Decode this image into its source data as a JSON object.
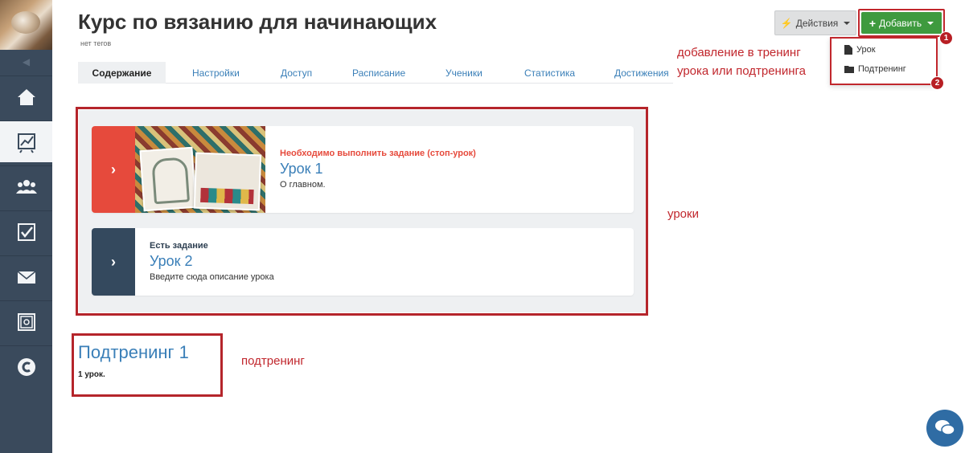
{
  "header": {
    "title": "Курс по вязанию для начинающих",
    "tags": "нет тегов",
    "actions_label": "Действия",
    "add_label": "Добавить"
  },
  "dropdown": {
    "items": [
      {
        "label": "Урок",
        "icon": "file-icon"
      },
      {
        "label": "Подтренинг",
        "icon": "folder-icon"
      }
    ],
    "badges": [
      "1",
      "2"
    ]
  },
  "tabs": [
    {
      "label": "Содержание",
      "active": true
    },
    {
      "label": "Настройки"
    },
    {
      "label": "Доступ"
    },
    {
      "label": "Расписание"
    },
    {
      "label": "Ученики"
    },
    {
      "label": "Статистика"
    },
    {
      "label": "Достижения"
    }
  ],
  "lessons": [
    {
      "status": "Необходимо выполнить задание (стоп-урок)",
      "title": "Урок 1",
      "description": "О главном.",
      "accent": "#e64a3c"
    },
    {
      "status": "Есть задание",
      "title": "Урок 2",
      "description": "Введите сюда описание урока",
      "accent": "#34495e"
    }
  ],
  "subtraining": {
    "title": "Подтренинг 1",
    "count": "1 урок."
  },
  "annotations": {
    "add_line1": "добавление в тренинг",
    "add_line2": "урока или подтренинга",
    "lessons": "уроки",
    "subtraining": "подтренинг"
  },
  "sidebar": {
    "items": [
      "home-icon",
      "chart-icon",
      "users-icon",
      "checkbox-icon",
      "mail-icon",
      "safe-icon",
      "copyright-icon"
    ]
  },
  "colors": {
    "sidebar": "#3a4a5c",
    "link": "#3a7fb8",
    "add_button": "#3e9a3e",
    "annotation": "#c1272d"
  }
}
